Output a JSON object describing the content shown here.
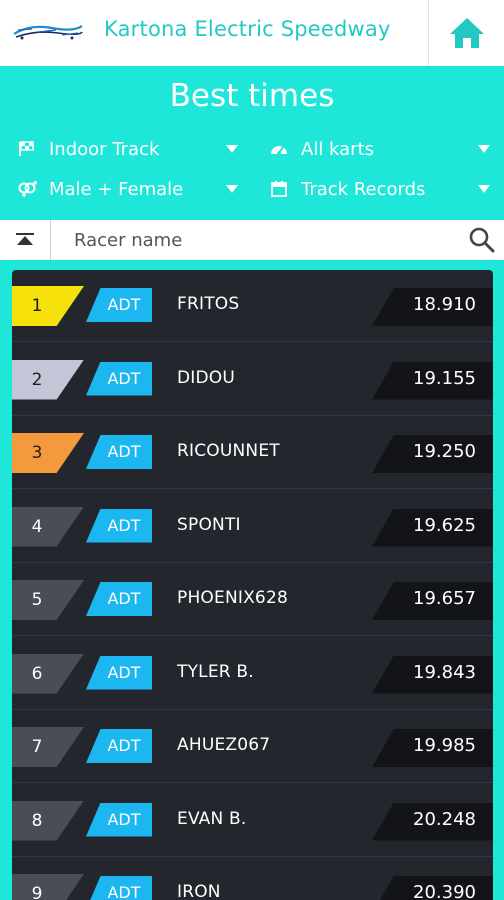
{
  "header": {
    "app_title": "Kartona Electric Speedway",
    "logo_icon": "kartona-logo",
    "home_icon": "home-icon"
  },
  "page": {
    "title": "Best times"
  },
  "filters": {
    "track": {
      "label": "Indoor Track",
      "icon": "flag-icon"
    },
    "karts": {
      "label": "All karts",
      "icon": "speedometer-icon"
    },
    "gender": {
      "label": "Male + Female",
      "icon": "gender-icon"
    },
    "period": {
      "label": "Track Records",
      "icon": "calendar-icon"
    }
  },
  "search": {
    "placeholder": "Racer name",
    "scroll_top_icon": "scroll-to-top-icon",
    "search_icon": "search-icon"
  },
  "colors": {
    "accent": "#1ee6d8",
    "gold": "#f6e20a",
    "silver": "#c3c6d6",
    "bronze": "#f39a3c",
    "default_rank": "#4a4d55",
    "kart_badge": "#1cb7f0"
  },
  "rows": [
    {
      "rank": "1",
      "kart": "ADT",
      "name": "FRITOS",
      "time": "18.910",
      "medal": "gold"
    },
    {
      "rank": "2",
      "kart": "ADT",
      "name": "DIDOU",
      "time": "19.155",
      "medal": "silver"
    },
    {
      "rank": "3",
      "kart": "ADT",
      "name": "RICOUNNET",
      "time": "19.250",
      "medal": "bronze"
    },
    {
      "rank": "4",
      "kart": "ADT",
      "name": "SPONTI",
      "time": "19.625",
      "medal": "none"
    },
    {
      "rank": "5",
      "kart": "ADT",
      "name": "PHOENIX628",
      "time": "19.657",
      "medal": "none"
    },
    {
      "rank": "6",
      "kart": "ADT",
      "name": "TYLER B.",
      "time": "19.843",
      "medal": "none"
    },
    {
      "rank": "7",
      "kart": "ADT",
      "name": "AHUEZ067",
      "time": "19.985",
      "medal": "none"
    },
    {
      "rank": "8",
      "kart": "ADT",
      "name": "EVAN B.",
      "time": "20.248",
      "medal": "none"
    },
    {
      "rank": "9",
      "kart": "ADT",
      "name": "IRON",
      "time": "20.390",
      "medal": "none"
    }
  ]
}
